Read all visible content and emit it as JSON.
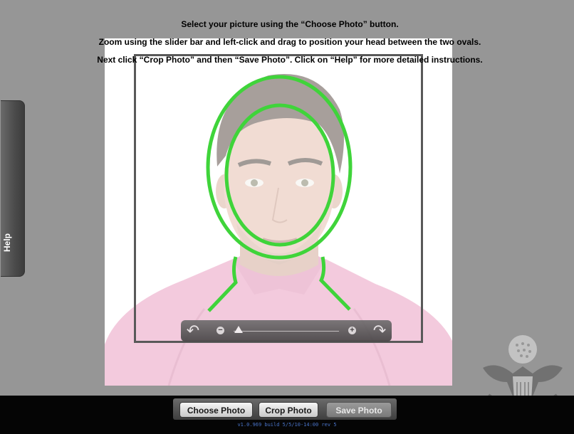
{
  "instructions": {
    "line1": "Select your picture using the “Choose Photo” button.",
    "line2": "Zoom using the slider bar and left-click and drag to position your head between the two ovals.",
    "line3": "Next click “Crop Photo” and then “Save Photo”.  Click on “Help” for more detailed instructions."
  },
  "help_tab": {
    "label": "Help"
  },
  "crop_tool": {
    "guide_color": "#3fd43a",
    "rotate_left_icon": "↶",
    "rotate_right_icon": "↷",
    "zoom_out_icon": "−",
    "zoom_in_icon": "+",
    "zoom_level": 0.05
  },
  "toolbar": {
    "choose_label": "Choose Photo",
    "crop_label": "Crop Photo",
    "save_label": "Save Photo",
    "save_enabled": false
  },
  "footer": {
    "version": "v1.0.969 build 5/5/10-14:00 rev 5"
  },
  "colors": {
    "background": "#969696",
    "bar": "#050505",
    "shirt": "#e48bb4",
    "version_text": "#4a74c9"
  }
}
